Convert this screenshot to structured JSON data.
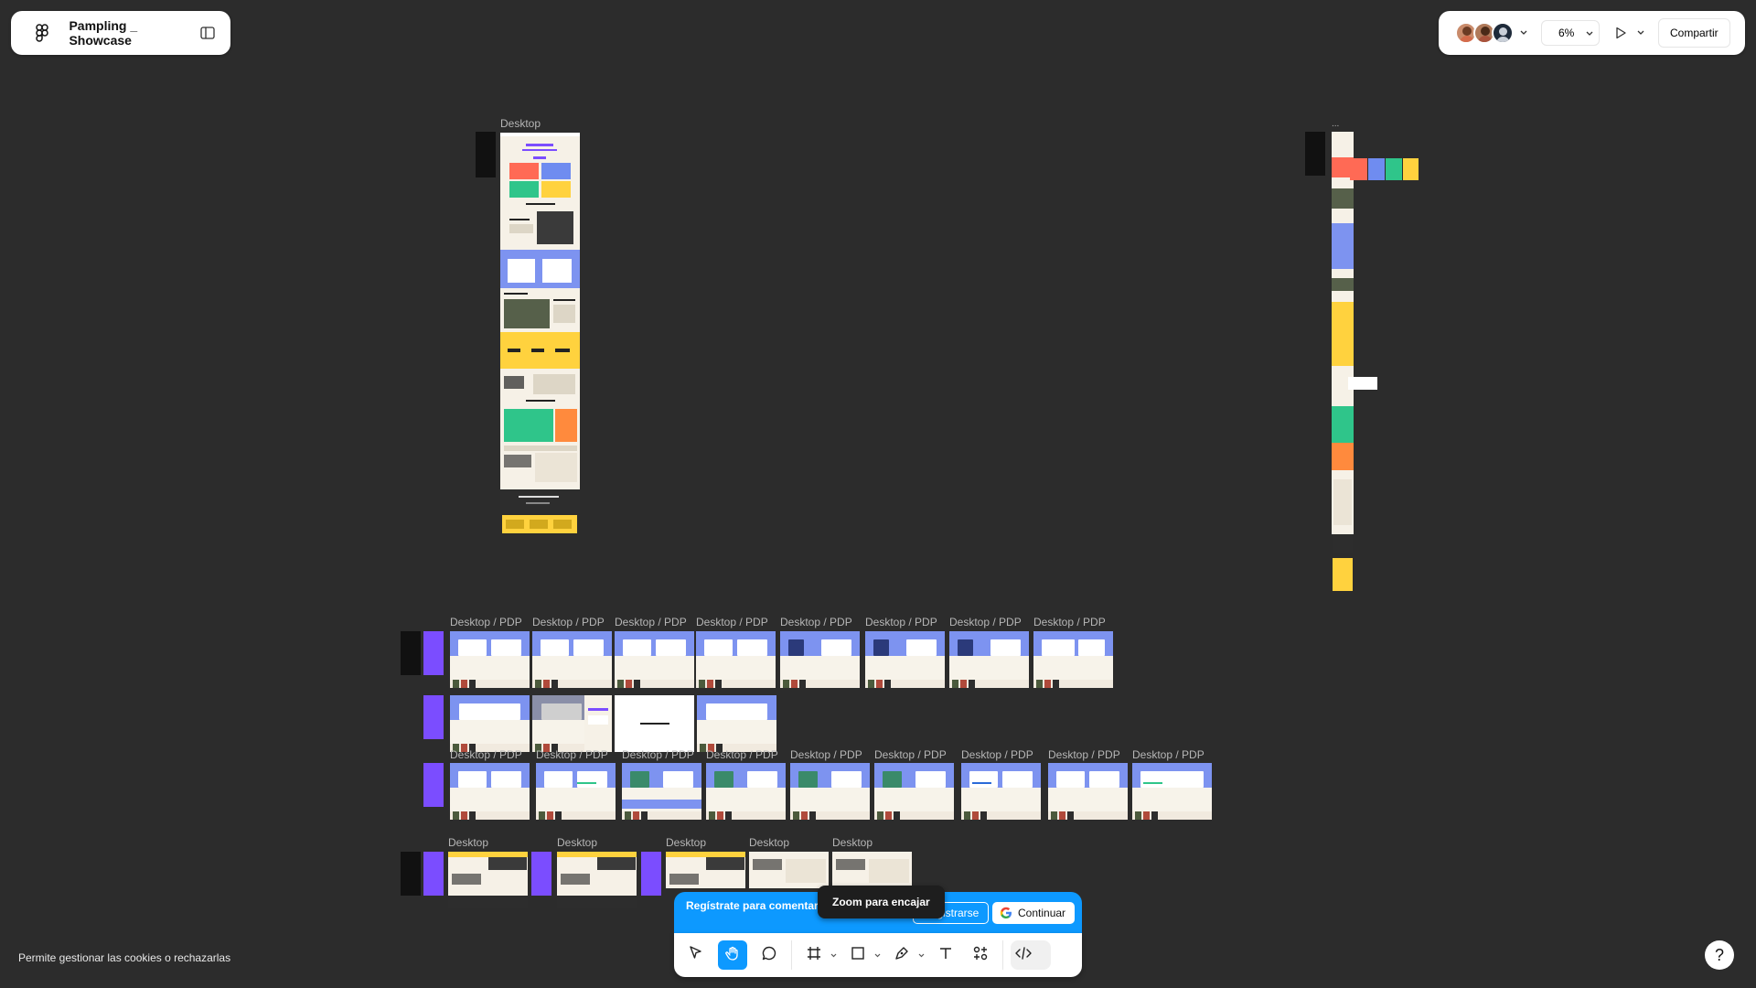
{
  "file": {
    "title": "Pampling _ Showcase"
  },
  "topbar": {
    "zoom": "6%",
    "share_label": "Compartir"
  },
  "canvas": {
    "labels": {
      "desktop": "Desktop",
      "pdp": "Desktop / PDP",
      "ellipsis": "..."
    }
  },
  "banner": {
    "message": "Regístrate para comentar, editar y más.",
    "register_label": "Registrarse",
    "continue_label": "Continuar"
  },
  "tooltip": {
    "text": "Zoom para encajar"
  },
  "cookies": {
    "text": "Permite gestionar las cookies o rechazarlas"
  },
  "help": {
    "label": "?"
  },
  "colors": {
    "accent": "#0d99ff",
    "canvas": "#2c2c2c",
    "purple": "#7b4dff"
  }
}
